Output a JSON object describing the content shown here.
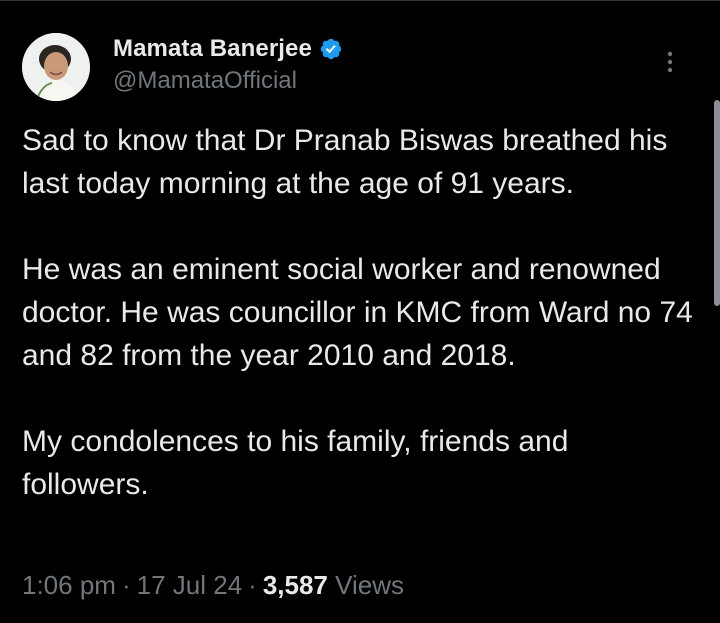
{
  "author": {
    "display_name": "Mamata Banerjee",
    "handle": "@MamataOfficial",
    "verified": true
  },
  "tweet": {
    "paragraphs": [
      "Sad to know that Dr Pranab Biswas breathed his last today morning at the age of 91 years.",
      "He was an eminent social worker and renowned doctor. He was councillor in KMC from Ward no 74 and 82 from the year 2010 and 2018.",
      "My condolences to his family, friends and followers."
    ]
  },
  "meta": {
    "time": "1:06 pm",
    "date": "17 Jul 24",
    "separator": "·",
    "views_count": "3,587",
    "views_label": "Views"
  },
  "icons": {
    "verified": "verified-badge-icon",
    "more": "more-vertical-icon"
  },
  "colors": {
    "background": "#000000",
    "text_primary": "#e7e9ea",
    "text_secondary": "#71767b",
    "verified_blue": "#1d9bf0"
  }
}
